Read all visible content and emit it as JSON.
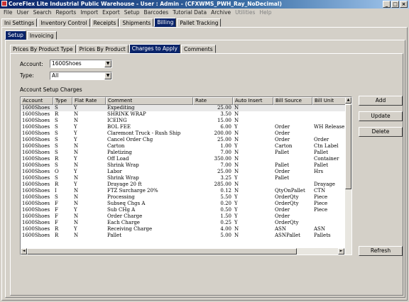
{
  "window": {
    "title": "CoreFlex Lite Industrial Public Warehouse - User : Admin - (CFXWMS_PWH_Ray_NoDecimal)",
    "buttons": {
      "minimize": "_",
      "maximize": "□",
      "close": "×"
    }
  },
  "menu": [
    "File",
    "User",
    "Search",
    "Reports",
    "Import",
    "Export",
    "Setup",
    "Barcodes",
    "Tutorial Data",
    "Archive",
    "Utilities",
    "Help"
  ],
  "main_tabs": [
    "Ini Settings",
    "Inventory Control",
    "Receipts",
    "Shipments",
    "Billing",
    "Pallet Tracking"
  ],
  "sub_tabs": [
    "Setup",
    "Invoicing"
  ],
  "inner_tabs": [
    "Prices By Product Type",
    "Prices By Product",
    "Charges to Apply",
    "Comments"
  ],
  "form": {
    "account_label": "Account:",
    "account_value": "1600Shoes",
    "type_label": "Type:",
    "type_value": "All",
    "section_label": "Account Setup Charges"
  },
  "table": {
    "columns": [
      "Account",
      "Type",
      "Flat Rate",
      "Comment",
      "Rate",
      "Auto Insert",
      "Bill Source",
      "Bill Unit"
    ],
    "rows": [
      [
        "1600Shoes",
        "S",
        "Y",
        "Expediting",
        "25.00",
        "N",
        "",
        ""
      ],
      [
        "1600Shoes",
        "R",
        "N",
        "SHRINK WRAP",
        "3.50",
        "N",
        "",
        ""
      ],
      [
        "1600Shoes",
        "S",
        "N",
        "ICEING",
        "15.00",
        "N",
        "",
        ""
      ],
      [
        "1600Shoes",
        "S",
        "Y",
        "BOL FEE",
        "6.00",
        "Y",
        "Order",
        "WH Release"
      ],
      [
        "1600Shoes",
        "S",
        "Y",
        "Claremont Truck - Rush Ship",
        "200.00",
        "N",
        "Order",
        ""
      ],
      [
        "1600Shoes",
        "S",
        "Y",
        "Cancel Order Chg",
        "25.00",
        "N",
        "Order",
        "Order"
      ],
      [
        "1600Shoes",
        "S",
        "N",
        "Carton",
        "1.00",
        "Y",
        "Carton",
        "Ctn Label"
      ],
      [
        "1600Shoes",
        "S",
        "N",
        "Paletizing",
        "7.00",
        "N",
        "Pallet",
        "Pallet"
      ],
      [
        "1600Shoes",
        "R",
        "Y",
        "Off Load",
        "350.00",
        "N",
        "",
        "Container"
      ],
      [
        "1600Shoes",
        "S",
        "N",
        "Shrink Wrap",
        "7.00",
        "N",
        "Pallet",
        "Pallet"
      ],
      [
        "1600Shoes",
        "O",
        "Y",
        "Labor",
        "25.00",
        "N",
        "Order",
        "Hrs"
      ],
      [
        "1600Shoes",
        "S",
        "N",
        "Shrink Wrap",
        "3.25",
        "Y",
        "Pallet",
        ""
      ],
      [
        "1600Shoes",
        "R",
        "Y",
        "Drayage 20 ft",
        "285.00",
        "N",
        "",
        "Drayage"
      ],
      [
        "1600Shoes",
        "I",
        "N",
        "FTZ Surcharge 20%",
        "0.12",
        "N",
        "QtyOnPallet",
        "CTN"
      ],
      [
        "1600Shoes",
        "S",
        "N",
        "Processing",
        "5.50",
        "Y",
        "OrderQty",
        "Piece"
      ],
      [
        "1600Shoes",
        "F",
        "N",
        "Subseq Chgs A",
        "0.20",
        "Y",
        "OrderQty",
        "Piece"
      ],
      [
        "1600Shoes",
        "F",
        "Y",
        "Sub CHg A",
        "0.50",
        "Y",
        "Order",
        "Piece"
      ],
      [
        "1600Shoes",
        "F",
        "N",
        "Order Charge",
        "1.50",
        "Y",
        "Order",
        ""
      ],
      [
        "1600Shoes",
        "F",
        "N",
        "Each Charge",
        "0.25",
        "Y",
        "OrderQty",
        ""
      ],
      [
        "1600Shoes",
        "R",
        "Y",
        "Receiving Charge",
        "4.00",
        "N",
        "ASN",
        "ASN"
      ],
      [
        "1600Shoes",
        "R",
        "N",
        "Pallet",
        "5.00",
        "N",
        "ASNPallet",
        "Pallets"
      ]
    ]
  },
  "buttons": {
    "add": "Add",
    "update": "Update",
    "delete": "Delete",
    "refresh": "Refresh"
  },
  "scroll": {
    "left": "◄",
    "right": "►",
    "up": "▲",
    "down": "▼"
  },
  "icons": {
    "dropdown": "▼"
  }
}
